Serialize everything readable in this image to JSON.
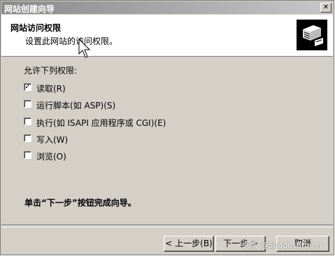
{
  "window": {
    "title": "网站创建向导",
    "close_glyph": "✕"
  },
  "header": {
    "title": "网站访问权限",
    "subtitle": "设置此网站的访问权限。"
  },
  "section_label": "允许下列权限:",
  "options": [
    {
      "label": "读取(R)",
      "checked": true
    },
    {
      "label": "运行脚本(如 ASP)(S)",
      "checked": false
    },
    {
      "label": "执行(如 ISAPI 应用程序或 CGI)(E)",
      "checked": false
    },
    {
      "label": "写入(W)",
      "checked": false
    },
    {
      "label": "浏览(O)",
      "checked": false
    }
  ],
  "finish_text": "单击“下一步”按钮完成向导。",
  "buttons": {
    "back": "< 上一步(B)",
    "next": "下一步 >",
    "cancel": "取消"
  },
  "watermark": "头条 @SpadesBroom",
  "icons": {
    "wizard": "wizard-book-icon",
    "cursor": "mouse-pointer-icon"
  }
}
